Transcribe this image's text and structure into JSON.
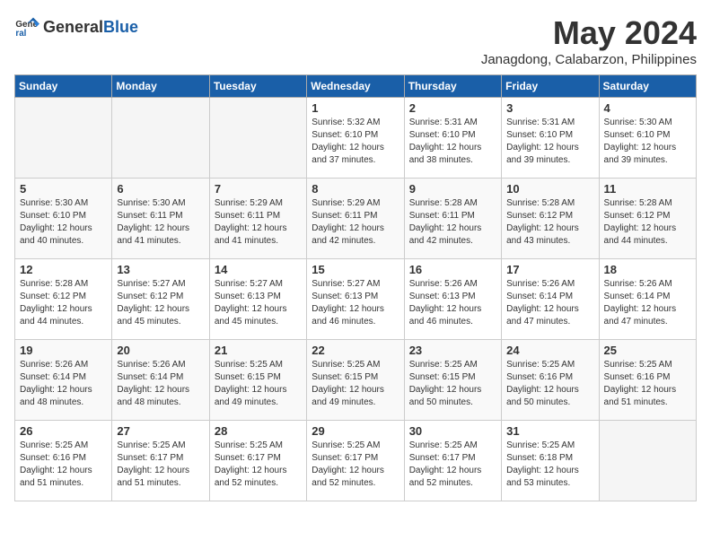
{
  "logo": {
    "general": "General",
    "blue": "Blue"
  },
  "title": "May 2024",
  "location": "Janagdong, Calabarzon, Philippines",
  "days_of_week": [
    "Sunday",
    "Monday",
    "Tuesday",
    "Wednesday",
    "Thursday",
    "Friday",
    "Saturday"
  ],
  "weeks": [
    [
      {
        "day": "",
        "sunrise": "",
        "sunset": "",
        "daylight": ""
      },
      {
        "day": "",
        "sunrise": "",
        "sunset": "",
        "daylight": ""
      },
      {
        "day": "",
        "sunrise": "",
        "sunset": "",
        "daylight": ""
      },
      {
        "day": "1",
        "sunrise": "Sunrise: 5:32 AM",
        "sunset": "Sunset: 6:10 PM",
        "daylight": "Daylight: 12 hours and 37 minutes."
      },
      {
        "day": "2",
        "sunrise": "Sunrise: 5:31 AM",
        "sunset": "Sunset: 6:10 PM",
        "daylight": "Daylight: 12 hours and 38 minutes."
      },
      {
        "day": "3",
        "sunrise": "Sunrise: 5:31 AM",
        "sunset": "Sunset: 6:10 PM",
        "daylight": "Daylight: 12 hours and 39 minutes."
      },
      {
        "day": "4",
        "sunrise": "Sunrise: 5:30 AM",
        "sunset": "Sunset: 6:10 PM",
        "daylight": "Daylight: 12 hours and 39 minutes."
      }
    ],
    [
      {
        "day": "5",
        "sunrise": "Sunrise: 5:30 AM",
        "sunset": "Sunset: 6:10 PM",
        "daylight": "Daylight: 12 hours and 40 minutes."
      },
      {
        "day": "6",
        "sunrise": "Sunrise: 5:30 AM",
        "sunset": "Sunset: 6:11 PM",
        "daylight": "Daylight: 12 hours and 41 minutes."
      },
      {
        "day": "7",
        "sunrise": "Sunrise: 5:29 AM",
        "sunset": "Sunset: 6:11 PM",
        "daylight": "Daylight: 12 hours and 41 minutes."
      },
      {
        "day": "8",
        "sunrise": "Sunrise: 5:29 AM",
        "sunset": "Sunset: 6:11 PM",
        "daylight": "Daylight: 12 hours and 42 minutes."
      },
      {
        "day": "9",
        "sunrise": "Sunrise: 5:28 AM",
        "sunset": "Sunset: 6:11 PM",
        "daylight": "Daylight: 12 hours and 42 minutes."
      },
      {
        "day": "10",
        "sunrise": "Sunrise: 5:28 AM",
        "sunset": "Sunset: 6:12 PM",
        "daylight": "Daylight: 12 hours and 43 minutes."
      },
      {
        "day": "11",
        "sunrise": "Sunrise: 5:28 AM",
        "sunset": "Sunset: 6:12 PM",
        "daylight": "Daylight: 12 hours and 44 minutes."
      }
    ],
    [
      {
        "day": "12",
        "sunrise": "Sunrise: 5:28 AM",
        "sunset": "Sunset: 6:12 PM",
        "daylight": "Daylight: 12 hours and 44 minutes."
      },
      {
        "day": "13",
        "sunrise": "Sunrise: 5:27 AM",
        "sunset": "Sunset: 6:12 PM",
        "daylight": "Daylight: 12 hours and 45 minutes."
      },
      {
        "day": "14",
        "sunrise": "Sunrise: 5:27 AM",
        "sunset": "Sunset: 6:13 PM",
        "daylight": "Daylight: 12 hours and 45 minutes."
      },
      {
        "day": "15",
        "sunrise": "Sunrise: 5:27 AM",
        "sunset": "Sunset: 6:13 PM",
        "daylight": "Daylight: 12 hours and 46 minutes."
      },
      {
        "day": "16",
        "sunrise": "Sunrise: 5:26 AM",
        "sunset": "Sunset: 6:13 PM",
        "daylight": "Daylight: 12 hours and 46 minutes."
      },
      {
        "day": "17",
        "sunrise": "Sunrise: 5:26 AM",
        "sunset": "Sunset: 6:14 PM",
        "daylight": "Daylight: 12 hours and 47 minutes."
      },
      {
        "day": "18",
        "sunrise": "Sunrise: 5:26 AM",
        "sunset": "Sunset: 6:14 PM",
        "daylight": "Daylight: 12 hours and 47 minutes."
      }
    ],
    [
      {
        "day": "19",
        "sunrise": "Sunrise: 5:26 AM",
        "sunset": "Sunset: 6:14 PM",
        "daylight": "Daylight: 12 hours and 48 minutes."
      },
      {
        "day": "20",
        "sunrise": "Sunrise: 5:26 AM",
        "sunset": "Sunset: 6:14 PM",
        "daylight": "Daylight: 12 hours and 48 minutes."
      },
      {
        "day": "21",
        "sunrise": "Sunrise: 5:25 AM",
        "sunset": "Sunset: 6:15 PM",
        "daylight": "Daylight: 12 hours and 49 minutes."
      },
      {
        "day": "22",
        "sunrise": "Sunrise: 5:25 AM",
        "sunset": "Sunset: 6:15 PM",
        "daylight": "Daylight: 12 hours and 49 minutes."
      },
      {
        "day": "23",
        "sunrise": "Sunrise: 5:25 AM",
        "sunset": "Sunset: 6:15 PM",
        "daylight": "Daylight: 12 hours and 50 minutes."
      },
      {
        "day": "24",
        "sunrise": "Sunrise: 5:25 AM",
        "sunset": "Sunset: 6:16 PM",
        "daylight": "Daylight: 12 hours and 50 minutes."
      },
      {
        "day": "25",
        "sunrise": "Sunrise: 5:25 AM",
        "sunset": "Sunset: 6:16 PM",
        "daylight": "Daylight: 12 hours and 51 minutes."
      }
    ],
    [
      {
        "day": "26",
        "sunrise": "Sunrise: 5:25 AM",
        "sunset": "Sunset: 6:16 PM",
        "daylight": "Daylight: 12 hours and 51 minutes."
      },
      {
        "day": "27",
        "sunrise": "Sunrise: 5:25 AM",
        "sunset": "Sunset: 6:17 PM",
        "daylight": "Daylight: 12 hours and 51 minutes."
      },
      {
        "day": "28",
        "sunrise": "Sunrise: 5:25 AM",
        "sunset": "Sunset: 6:17 PM",
        "daylight": "Daylight: 12 hours and 52 minutes."
      },
      {
        "day": "29",
        "sunrise": "Sunrise: 5:25 AM",
        "sunset": "Sunset: 6:17 PM",
        "daylight": "Daylight: 12 hours and 52 minutes."
      },
      {
        "day": "30",
        "sunrise": "Sunrise: 5:25 AM",
        "sunset": "Sunset: 6:17 PM",
        "daylight": "Daylight: 12 hours and 52 minutes."
      },
      {
        "day": "31",
        "sunrise": "Sunrise: 5:25 AM",
        "sunset": "Sunset: 6:18 PM",
        "daylight": "Daylight: 12 hours and 53 minutes."
      },
      {
        "day": "",
        "sunrise": "",
        "sunset": "",
        "daylight": ""
      }
    ]
  ]
}
